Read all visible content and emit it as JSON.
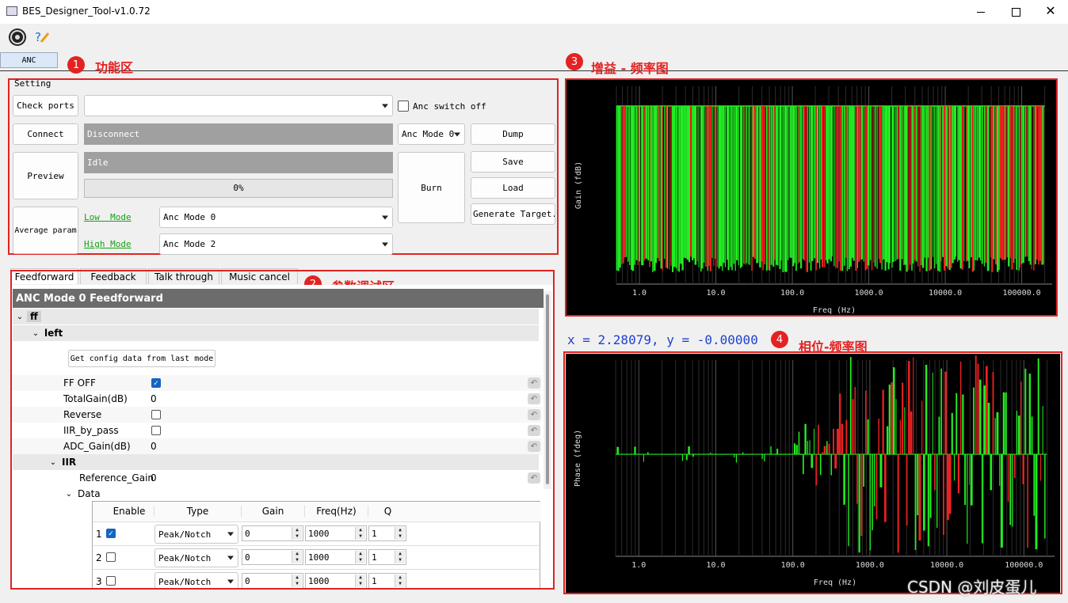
{
  "window": {
    "title": "BES_Designer_Tool-v1.0.72"
  },
  "toolbar": {
    "icons": [
      "settings-gear-icon",
      "help-brush-icon"
    ]
  },
  "main_tab": {
    "label": "ANC"
  },
  "annotations": {
    "a1": {
      "num": "1",
      "label": "功能区"
    },
    "a2": {
      "num": "2",
      "label": "参数调试区"
    },
    "a3": {
      "num": "3",
      "label": "增益 - 频率图"
    },
    "a4": {
      "num": "4",
      "label": "相位-频率图"
    }
  },
  "setting": {
    "group_title": "Setting",
    "check_ports": "Check ports",
    "port_value": "",
    "anc_switch_label": "Anc switch off",
    "anc_switch_checked": false,
    "connect": "Connect",
    "disconnect_status": "Disconnect",
    "anc_mode_select": "Anc Mode 0",
    "dump": "Dump",
    "preview": "Preview",
    "idle_status": "Idle",
    "progress_text": "0%",
    "progress_fraction": 0,
    "burn": "Burn",
    "save": "Save",
    "load": "Load",
    "generate": "Generate Target.c",
    "average_param": "Average param",
    "low_mode_label": "Low  Mode",
    "low_mode_value": "Anc Mode 0",
    "high_mode_label": "High Mode",
    "high_mode_value": "Anc Mode 2"
  },
  "param_tabs": [
    {
      "label": "Feedforward",
      "active": true
    },
    {
      "label": "Feedback",
      "active": false
    },
    {
      "label": "Talk through",
      "active": false
    },
    {
      "label": "Music cancel",
      "active": false
    }
  ],
  "tree": {
    "header": "ANC Mode 0 Feedforward",
    "node_ff": "ff",
    "node_left": "left",
    "get_config_button": "Get config data from last mode",
    "params": [
      {
        "label": "FF OFF",
        "type": "checkbox",
        "checked": true,
        "value": ""
      },
      {
        "label": "TotalGain(dB)",
        "type": "value",
        "checked": false,
        "value": "0"
      },
      {
        "label": "Reverse",
        "type": "checkbox",
        "checked": false,
        "value": ""
      },
      {
        "label": "IIR_by_pass",
        "type": "checkbox",
        "checked": false,
        "value": ""
      },
      {
        "label": "ADC_Gain(dB)",
        "type": "value",
        "checked": false,
        "value": "0"
      }
    ],
    "node_iir": "IIR",
    "reference_gain_label": "Reference_Gain",
    "reference_gain_value": "0",
    "node_data": "Data",
    "columns": [
      "Enable",
      "Type",
      "Gain",
      "Freq(Hz)",
      "Q"
    ],
    "rows": [
      {
        "index": "1",
        "enabled": true,
        "type": "Peak/Notch",
        "gain": "0",
        "freq": "1000",
        "q": "1"
      },
      {
        "index": "2",
        "enabled": false,
        "type": "Peak/Notch",
        "gain": "0",
        "freq": "1000",
        "q": "1"
      },
      {
        "index": "3",
        "enabled": false,
        "type": "Peak/Notch",
        "gain": "0",
        "freq": "1000",
        "q": "1"
      }
    ]
  },
  "coords_readout": "x = 2.28079, y = -0.00000",
  "watermark": "CSDN @刘皮蛋儿",
  "colors": {
    "accent_red": "#e32222",
    "series_green": "#22ee22",
    "series_red": "#ee2222",
    "plot_bg": "#000000"
  },
  "chart_data": [
    {
      "type": "line",
      "title": "",
      "xlabel": "Freq (Hz)",
      "ylabel": "Gain (fdB)",
      "xscale": "log",
      "xlim": [
        0.5,
        250000
      ],
      "x_ticks": [
        "1.0",
        "10.0",
        "100.0",
        "1000.0",
        "10000.0",
        "100000.0"
      ],
      "grid": true,
      "legend": "none",
      "series": [
        {
          "color": "green",
          "values_note": "dense vertical lines spanning full y range"
        },
        {
          "color": "red",
          "values_note": "interleaved vertical lines"
        }
      ]
    },
    {
      "type": "line",
      "title": "",
      "xlabel": "Freq (Hz)",
      "ylabel": "Phase (fdeg)",
      "xscale": "log",
      "xlim": [
        0.5,
        250000
      ],
      "x_ticks": [
        "1.0",
        "10.0",
        "100.0",
        "1000.0",
        "10000.0",
        "100000.0"
      ],
      "grid": true,
      "legend": "none",
      "series": [
        {
          "color": "green",
          "values_note": "flat near 0 below 100 Hz, oscillating above"
        },
        {
          "color": "red",
          "values_note": "oscillating above 500 Hz"
        }
      ]
    }
  ]
}
